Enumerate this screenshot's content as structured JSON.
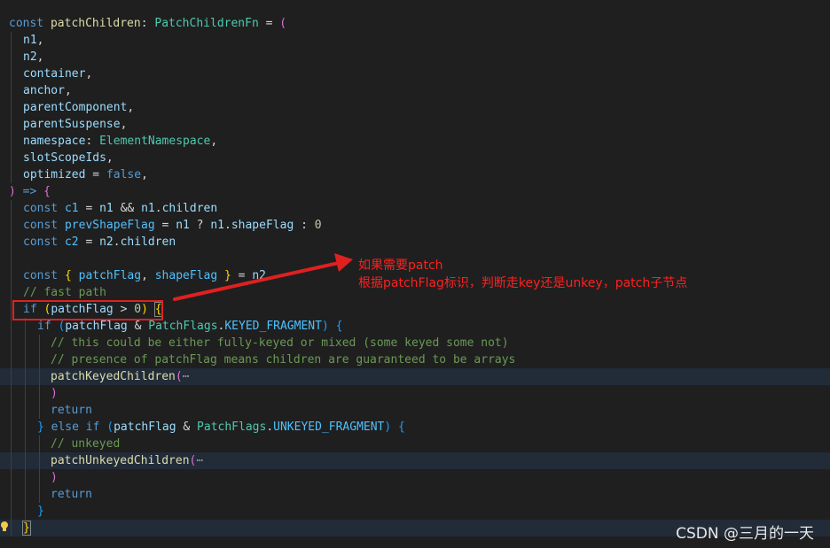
{
  "annotation": {
    "line1": "如果需要patch",
    "line2": "根据patchFlag标识，判断走key还是unkey，patch子节点"
  },
  "watermark": "CSDN @三月的一天",
  "code": {
    "l1": {
      "k1": "const",
      "name": "patchChildren",
      "colon": ": ",
      "type": "PatchChildrenFn",
      "eq": " = ",
      "paren": "("
    },
    "l2": "n1",
    "l3": "n2",
    "l4": "container",
    "l5": "anchor",
    "l6": "parentComponent",
    "l7": "parentSuspense",
    "l8": {
      "name": "namespace",
      "colon": ": ",
      "type": "ElementNamespace"
    },
    "l9": "slotScopeIds",
    "l10": {
      "name": "optimized",
      "eq": " = ",
      "val": "false"
    },
    "l11": {
      "paren": ")",
      "arrow": " => ",
      "brace": "{"
    },
    "l12": {
      "k": "const",
      "name": "c1",
      "eq": " = ",
      "a": "n1",
      "op": " && ",
      "b": "n1",
      "dot": ".",
      "prop": "children"
    },
    "l13": {
      "k": "const",
      "name": "prevShapeFlag",
      "eq": " = ",
      "a": "n1",
      "q": " ? ",
      "b": "n1",
      "dot": ".",
      "prop": "shapeFlag",
      "colon": " : ",
      "num": "0"
    },
    "l14": {
      "k": "const",
      "name": "c2",
      "eq": " = ",
      "a": "n2",
      "dot": ".",
      "prop": "children"
    },
    "l16": {
      "k": "const",
      "ob": "{ ",
      "a": "patchFlag",
      "comma": ", ",
      "b": "shapeFlag",
      "cb": " }",
      "eq": " = ",
      "c": "n2"
    },
    "l17": "// fast path",
    "l18": {
      "k": "if",
      "op": "(",
      "a": "patchFlag",
      "gt": " > ",
      "num": "0",
      "cp": ")",
      "brace": "{"
    },
    "l19": {
      "k": "if",
      "op": "(",
      "a": "patchFlag",
      "amp": " & ",
      "b": "PatchFlags",
      "dot": ".",
      "c": "KEYED_FRAGMENT",
      "cp": ")",
      "brace": "{"
    },
    "l20": "// this could be either fully-keyed or mixed (some keyed some not)",
    "l21": "// presence of patchFlag means children are guaranteed to be arrays",
    "l22": {
      "fn": "patchKeyedChildren",
      "paren": "(",
      "ellipsis": "⋯"
    },
    "l23": ")",
    "l24": "return",
    "l25": {
      "cb": "}",
      "k1": "else",
      "k2": "if",
      "op": "(",
      "a": "patchFlag",
      "amp": " & ",
      "b": "PatchFlags",
      "dot": ".",
      "c": "UNKEYED_FRAGMENT",
      "cp": ")",
      "brace": "{"
    },
    "l26": "// unkeyed",
    "l27": {
      "fn": "patchUnkeyedChildren",
      "paren": "(",
      "ellipsis": "⋯"
    },
    "l28": ")",
    "l29": "return",
    "l30": "}",
    "l31": "}"
  },
  "colors": {
    "background": "#1f1f1f",
    "keyword": "#569cd6",
    "variable": "#9cdcfe",
    "function": "#dcdcaa",
    "type": "#4ec9b0",
    "comment": "#6a9955",
    "annotation": "#ff2020"
  }
}
